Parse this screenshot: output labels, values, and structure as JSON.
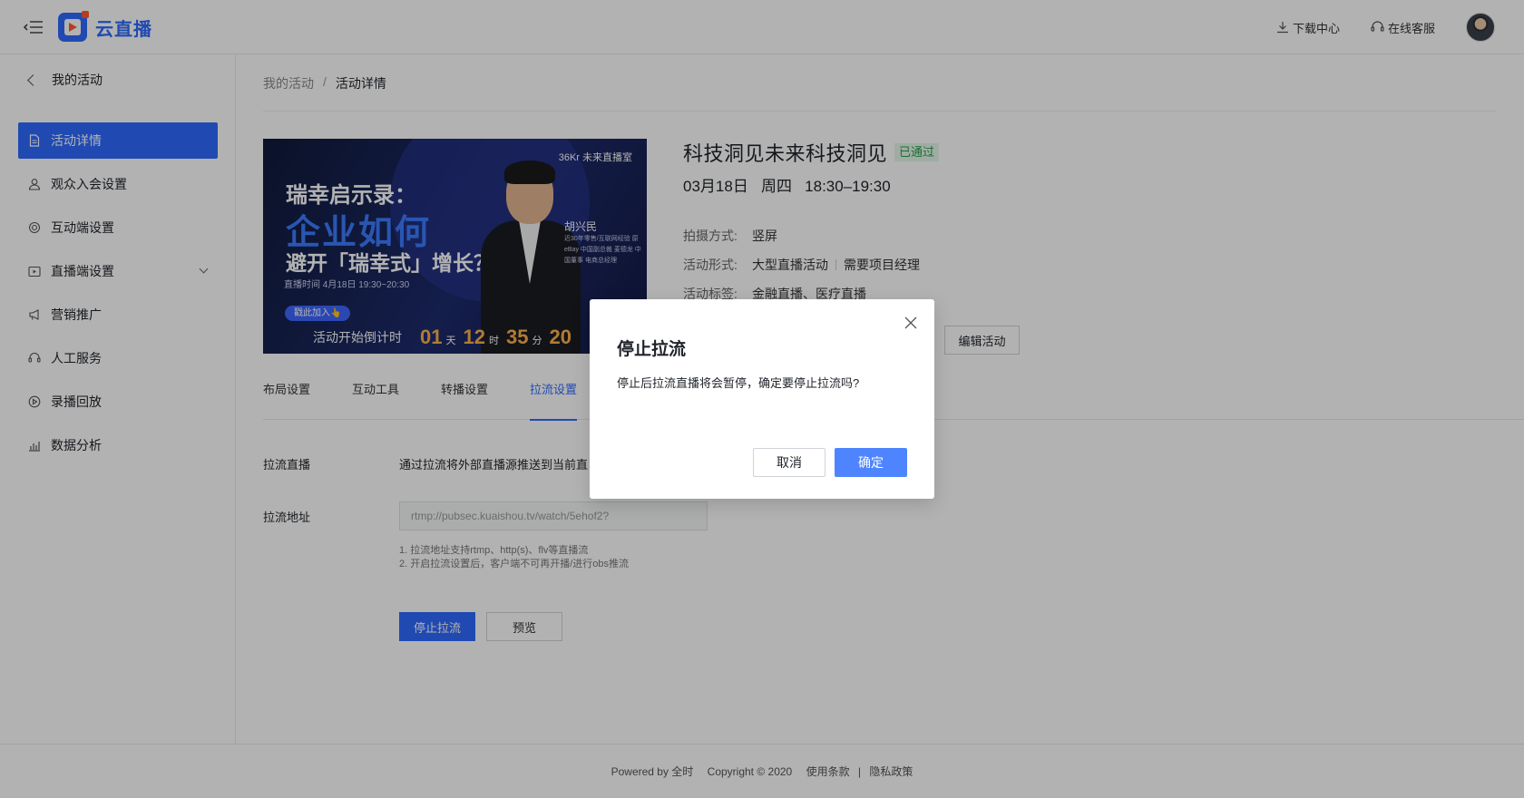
{
  "header": {
    "brand": "云直播",
    "download_center": "下载中心",
    "online_service": "在线客服"
  },
  "sidebar": {
    "back_label": "我的活动",
    "items": [
      {
        "label": "活动详情",
        "icon": "document-icon",
        "active": true
      },
      {
        "label": "观众入会设置",
        "icon": "user-icon",
        "active": false
      },
      {
        "label": "互动端设置",
        "icon": "target-icon",
        "active": false
      },
      {
        "label": "直播端设置",
        "icon": "broadcast-icon",
        "active": false
      },
      {
        "label": "营销推广",
        "icon": "megaphone-icon",
        "active": false
      },
      {
        "label": "人工服务",
        "icon": "headset-icon",
        "active": false
      },
      {
        "label": "录播回放",
        "icon": "play-circle-icon",
        "active": false
      },
      {
        "label": "数据分析",
        "icon": "chart-icon",
        "active": false
      }
    ]
  },
  "breadcrumb": {
    "parent": "我的活动",
    "separator": "/",
    "current": "活动详情"
  },
  "poster": {
    "brand": "36Kr 未来直播室",
    "line1": "瑞幸启示录：",
    "line2": "企业如何",
    "line3": "避开「瑞幸式」增长？",
    "live_time": "直播时间 4月18日 19:30~20:30",
    "speaker_name": "胡兴民",
    "speaker_desc": "近30年零售/互联网经验 原eBay 中国副总裁 麦德龙 中国董事 电商总经理",
    "join_label": "戳此加入👆",
    "countdown_label": "活动开始倒计时",
    "countdown": {
      "days": "01",
      "days_unit": "天",
      "hours": "12",
      "hours_unit": "时",
      "minutes": "35",
      "minutes_unit": "分",
      "seconds": "20"
    }
  },
  "activity": {
    "title": "科技洞见未来科技洞见",
    "status": "已通过",
    "datetime": "03月18日   周四   18:30–19:30",
    "shoot_mode_label": "拍摄方式:",
    "shoot_mode": "竖屏",
    "form_label": "活动形式:",
    "form_value": "大型直播活动",
    "form_extra": "需要项目经理",
    "tags_label": "活动标签:",
    "tags": "金融直播、医疗直播",
    "edit_button": "编辑活动"
  },
  "tabs": [
    {
      "label": "布局设置",
      "active": false
    },
    {
      "label": "互动工具",
      "active": false
    },
    {
      "label": "转播设置",
      "active": false
    },
    {
      "label": "拉流设置",
      "active": true
    }
  ],
  "pull_stream": {
    "live_label": "拉流直播",
    "live_desc": "通过拉流将外部直播源推送到当前直",
    "address_label": "拉流地址",
    "address_value": "rtmp://pubsec.kuaishou.tv/watch/5ehof2?",
    "hint1": "1. 拉流地址支持rtmp、http(s)、flv等直播流",
    "hint2": "2. 开启拉流设置后，客户端不可再开播/进行obs推流",
    "stop_button": "停止拉流",
    "preview_button": "预览"
  },
  "footer": {
    "powered": "Powered by 全时",
    "copyright": "Copyright © 2020",
    "terms": "使用条款",
    "divider": "|",
    "privacy": "隐私政策"
  },
  "modal": {
    "title": "停止拉流",
    "body": "停止后拉流直播将会暂停，确定要停止拉流吗?",
    "cancel": "取消",
    "confirm": "确定"
  },
  "colors": {
    "primary": "#2f6bff",
    "confirm": "#4e85ff",
    "approved_bg": "#e6f6ea",
    "approved_text": "#21a04a",
    "countdown": "#ffb04a"
  }
}
